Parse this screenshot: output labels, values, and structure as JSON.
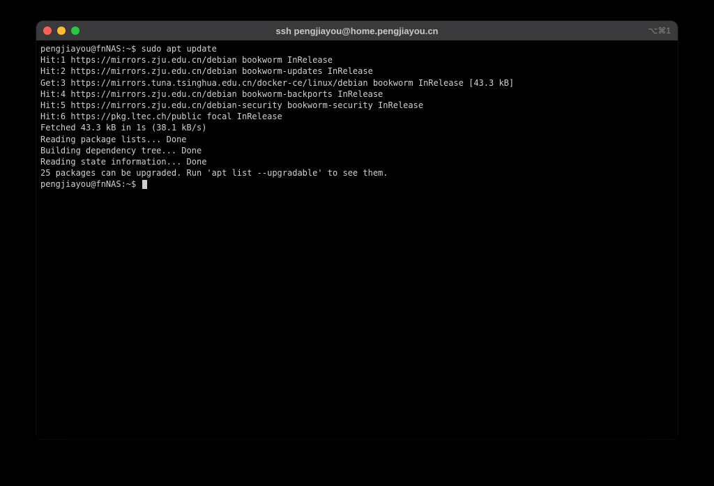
{
  "window": {
    "title": "ssh pengjiayou@home.pengjiayou.cn",
    "session_indicator": "⌥⌘1"
  },
  "terminal": {
    "prompt1": "pengjiayou@fnNAS:~$ ",
    "command1": "sudo apt update",
    "lines": [
      "Hit:1 https://mirrors.zju.edu.cn/debian bookworm InRelease",
      "Hit:2 https://mirrors.zju.edu.cn/debian bookworm-updates InRelease",
      "Get:3 https://mirrors.tuna.tsinghua.edu.cn/docker-ce/linux/debian bookworm InRelease [43.3 kB]",
      "Hit:4 https://mirrors.zju.edu.cn/debian bookworm-backports InRelease",
      "Hit:5 https://mirrors.zju.edu.cn/debian-security bookworm-security InRelease",
      "Hit:6 https://pkg.ltec.ch/public focal InRelease",
      "Fetched 43.3 kB in 1s (38.1 kB/s)",
      "Reading package lists... Done",
      "Building dependency tree... Done",
      "Reading state information... Done",
      "25 packages can be upgraded. Run 'apt list --upgradable' to see them."
    ],
    "prompt2": "pengjiayou@fnNAS:~$ "
  }
}
